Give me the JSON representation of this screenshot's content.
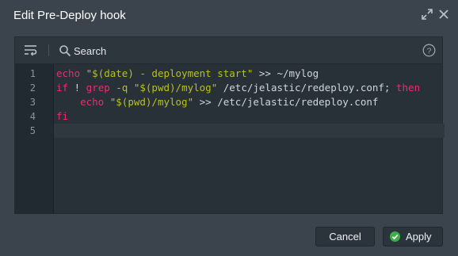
{
  "window": {
    "title": "Edit Pre-Deploy hook"
  },
  "toolbar": {
    "search_label": "Search"
  },
  "editor": {
    "line_numbers": [
      "1",
      "2",
      "3",
      "4",
      "5"
    ],
    "lines": [
      [
        {
          "t": "echo",
          "c": "kw"
        },
        {
          "t": " ",
          "c": ""
        },
        {
          "t": "\"$(date) - deployment start\"",
          "c": "str"
        },
        {
          "t": " >> ~/mylog",
          "c": "pth"
        }
      ],
      [
        {
          "t": "if",
          "c": "kw"
        },
        {
          "t": " ! ",
          "c": "pth"
        },
        {
          "t": "grep",
          "c": "kw"
        },
        {
          "t": " -q ",
          "c": "str"
        },
        {
          "t": "\"$(pwd)/mylog\"",
          "c": "str"
        },
        {
          "t": " /etc/jelastic/redeploy.conf; ",
          "c": "pth"
        },
        {
          "t": "then",
          "c": "kw"
        }
      ],
      [
        {
          "t": "    ",
          "c": ""
        },
        {
          "t": "echo",
          "c": "kw"
        },
        {
          "t": " ",
          "c": ""
        },
        {
          "t": "\"$(pwd)/mylog\"",
          "c": "str"
        },
        {
          "t": " >> /etc/jelastic/redeploy.conf",
          "c": "pth"
        }
      ],
      [
        {
          "t": "fi",
          "c": "kw"
        }
      ],
      []
    ]
  },
  "buttons": {
    "cancel_label": "Cancel",
    "apply_label": "Apply"
  },
  "icons": {
    "expand": "expand-icon",
    "close": "close-icon",
    "wrap": "wrap-lines-icon",
    "search": "search-icon",
    "help": "help-icon",
    "apply_check": "check-circle-icon"
  },
  "colors": {
    "keyword": "#e0336c",
    "string": "#b9c11e",
    "apply_check": "#3fae49"
  }
}
